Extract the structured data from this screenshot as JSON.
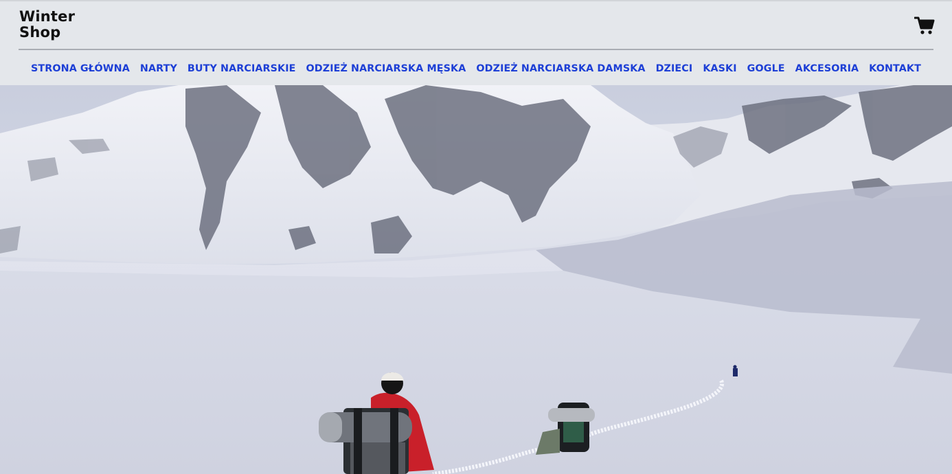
{
  "header": {
    "logo_line1": "Winter",
    "logo_line2": "Shop",
    "cart_icon": "shopping-cart-icon"
  },
  "nav": {
    "items": [
      "STRONA GŁÓWNA",
      "NARTY",
      "BUTY NARCIARSKIE",
      "ODZIEŻ NARCIARSKA MĘSKA",
      "ODZIEŻ NARCIARSKA DAMSKA",
      "DZIECI",
      "KASKI",
      "GOGLE",
      "AKCESORIA",
      "KONTAKT"
    ]
  },
  "colors": {
    "header_bg": "#e4e7eb",
    "nav_link": "#1d3fd6",
    "logo_text": "#111111"
  }
}
